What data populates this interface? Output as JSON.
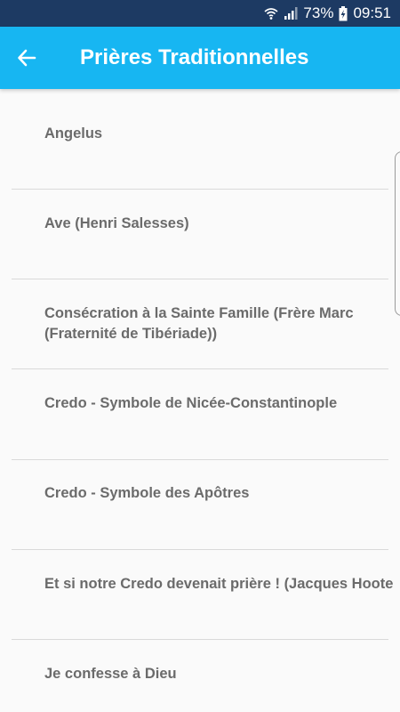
{
  "status_bar": {
    "battery_percent": "73%",
    "time": "09:51",
    "icons": [
      "wifi-icon",
      "signal-icon",
      "battery-charging-icon"
    ]
  },
  "app_bar": {
    "title": "Prières Traditionnelles",
    "back_icon": "arrow-left-icon",
    "color": "#17b6f2"
  },
  "list": {
    "items": [
      {
        "label": "Angelus"
      },
      {
        "label": "Ave (Henri Salesses)"
      },
      {
        "label": "Consécration à la Sainte Famille (Frère Marc (Fraternité de Tibériade))"
      },
      {
        "label": "Credo - Symbole de Nicée-Constantinople"
      },
      {
        "label": "Credo - Symbole des Apôtres"
      },
      {
        "label": "Et si notre Credo devenait prière ! (Jacques Hoote"
      },
      {
        "label": "Je confesse à Dieu"
      }
    ]
  }
}
